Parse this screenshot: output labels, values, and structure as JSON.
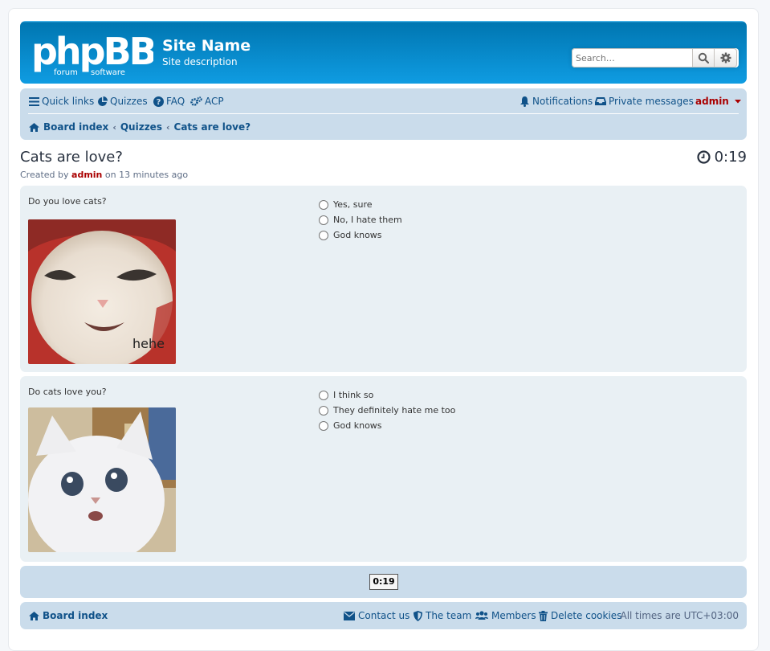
{
  "header": {
    "logo_text": "phpBB",
    "logo_sub1": "forum",
    "logo_sub2": "software",
    "site_name": "Site Name",
    "site_description": "Site description",
    "search_placeholder": "Search…"
  },
  "navbar": {
    "quick_links": "Quick links",
    "quizzes": "Quizzes",
    "faq": "FAQ",
    "acp": "ACP",
    "notifications": "Notifications",
    "private_messages": "Private messages",
    "username": "admin"
  },
  "breadcrumbs": [
    "Board index",
    "Quizzes",
    "Cats are love?"
  ],
  "page": {
    "title": "Cats are love?",
    "timer": "0:19",
    "created_prefix": "Created by",
    "created_user": "admin",
    "created_suffix": "on 13 minutes ago"
  },
  "questions": [
    {
      "text": "Do you love cats?",
      "image_caption": "hehe",
      "answers": [
        "Yes, sure",
        "No, I hate them",
        "God knows"
      ]
    },
    {
      "text": "Do cats love you?",
      "answers": [
        "I think so",
        "They definitely hate me too",
        "God knows"
      ]
    }
  ],
  "bottom_timer": "0:19",
  "footer": {
    "board_index": "Board index",
    "contact": "Contact us",
    "team": "The team",
    "members": "Members",
    "delete_cookies": "Delete cookies",
    "timezone": "All times are UTC+03:00"
  },
  "colors": {
    "link": "#105289",
    "navbar_bg": "#cadceb",
    "panel_bg": "#e9f0f4",
    "admin": "#aa0000"
  }
}
